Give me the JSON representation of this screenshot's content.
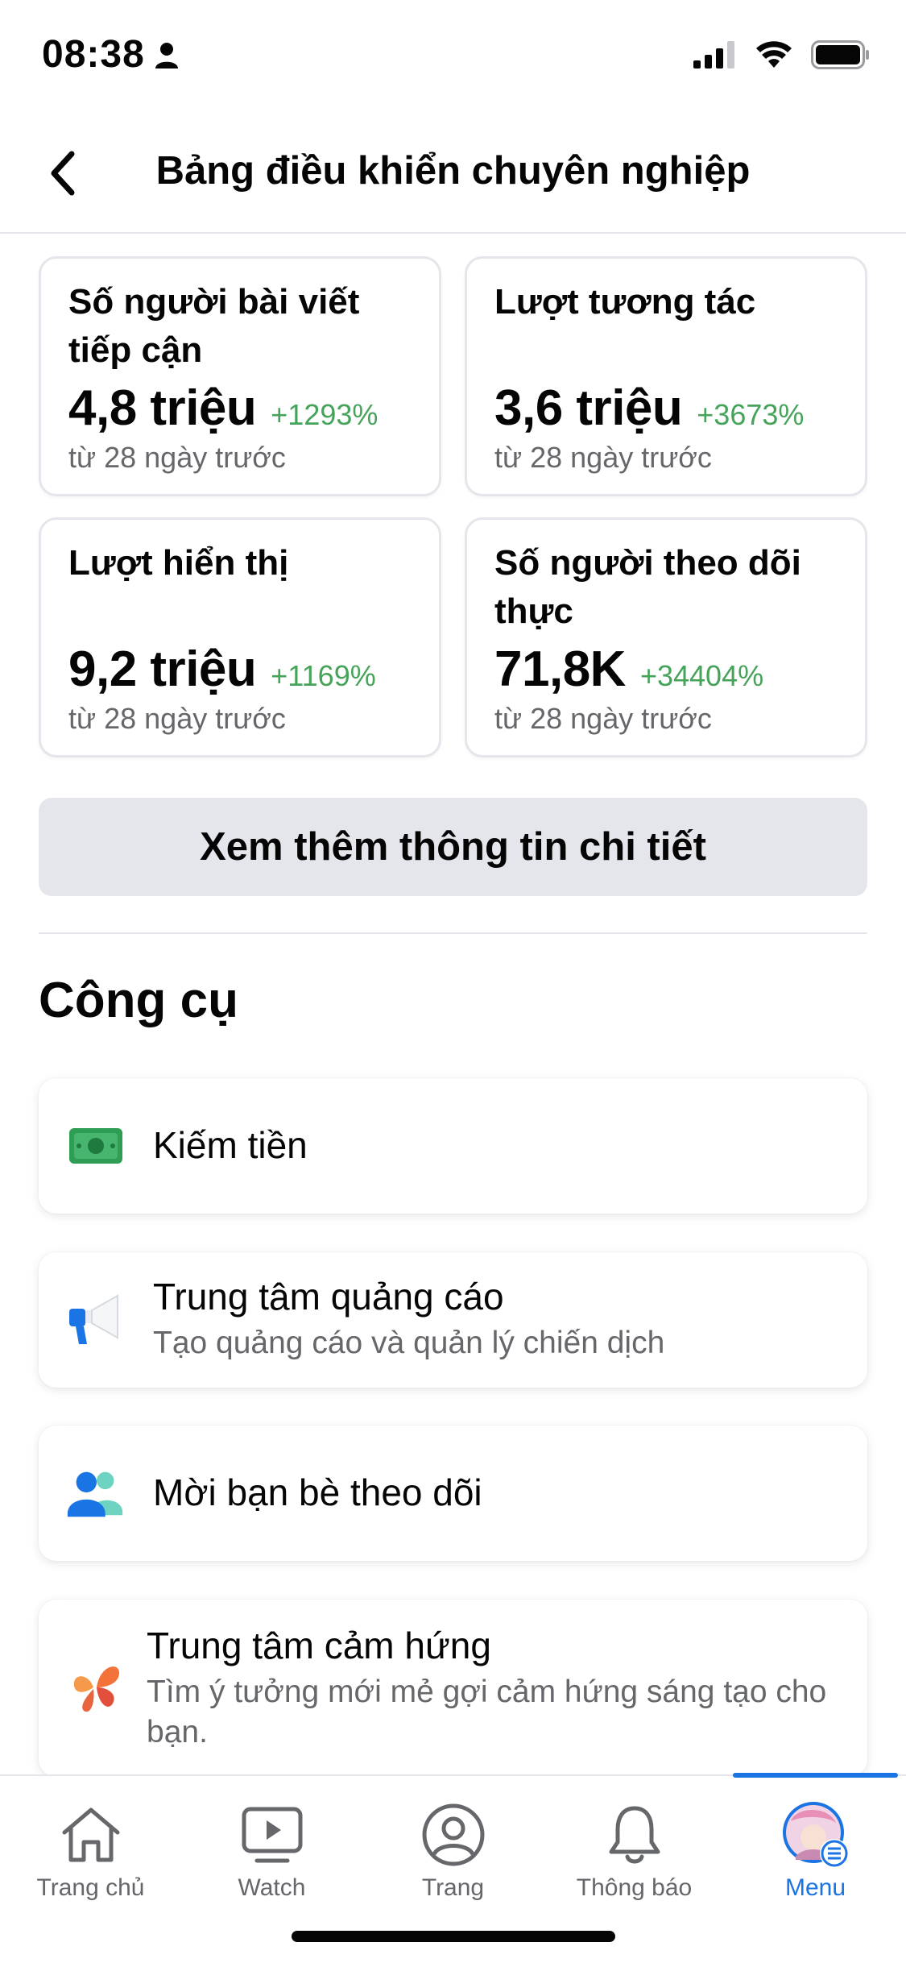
{
  "status_bar": {
    "time": "08:38"
  },
  "header": {
    "title": "Bảng điều khiển chuyên nghiệp"
  },
  "stats": [
    {
      "title": "Số người bài viết tiếp cận",
      "value": "4,8 triệu",
      "change": "+1293%",
      "note": "từ 28 ngày trước"
    },
    {
      "title": "Lượt tương tác",
      "value": "3,6 triệu",
      "change": "+3673%",
      "note": "từ 28 ngày trước"
    },
    {
      "title": "Lượt hiển thị",
      "value": "9,2 triệu",
      "change": "+1169%",
      "note": "từ 28 ngày trước"
    },
    {
      "title": "Số người theo dõi thực",
      "value": "71,8K",
      "change": "+34404%",
      "note": "từ 28 ngày trước"
    }
  ],
  "more_button": "Xem thêm thông tin chi tiết",
  "tools": {
    "title": "Công cụ",
    "items": [
      {
        "icon": "money-icon",
        "title": "Kiếm tiền",
        "subtitle": ""
      },
      {
        "icon": "megaphone-icon",
        "title": "Trung tâm quảng cáo",
        "subtitle": "Tạo quảng cáo và quản lý chiến dịch"
      },
      {
        "icon": "invite-friends-icon",
        "title": "Mời bạn bè theo dõi",
        "subtitle": ""
      },
      {
        "icon": "butterfly-icon",
        "title": "Trung tâm cảm hứng",
        "subtitle": "Tìm ý tưởng mới mẻ gợi cảm hứng sáng tạo cho bạn."
      }
    ]
  },
  "bottom_nav": [
    {
      "label": "Trang chủ",
      "icon": "home-icon"
    },
    {
      "label": "Watch",
      "icon": "watch-icon"
    },
    {
      "label": "Trang",
      "icon": "profile-icon"
    },
    {
      "label": "Thông báo",
      "icon": "bell-icon"
    },
    {
      "label": "Menu",
      "icon": "avatar-menu-icon",
      "active": true
    }
  ],
  "colors": {
    "accent": "#1b74e4",
    "positive": "#45a35a",
    "muted": "#65676b",
    "button_bg": "#e4e6eb"
  }
}
